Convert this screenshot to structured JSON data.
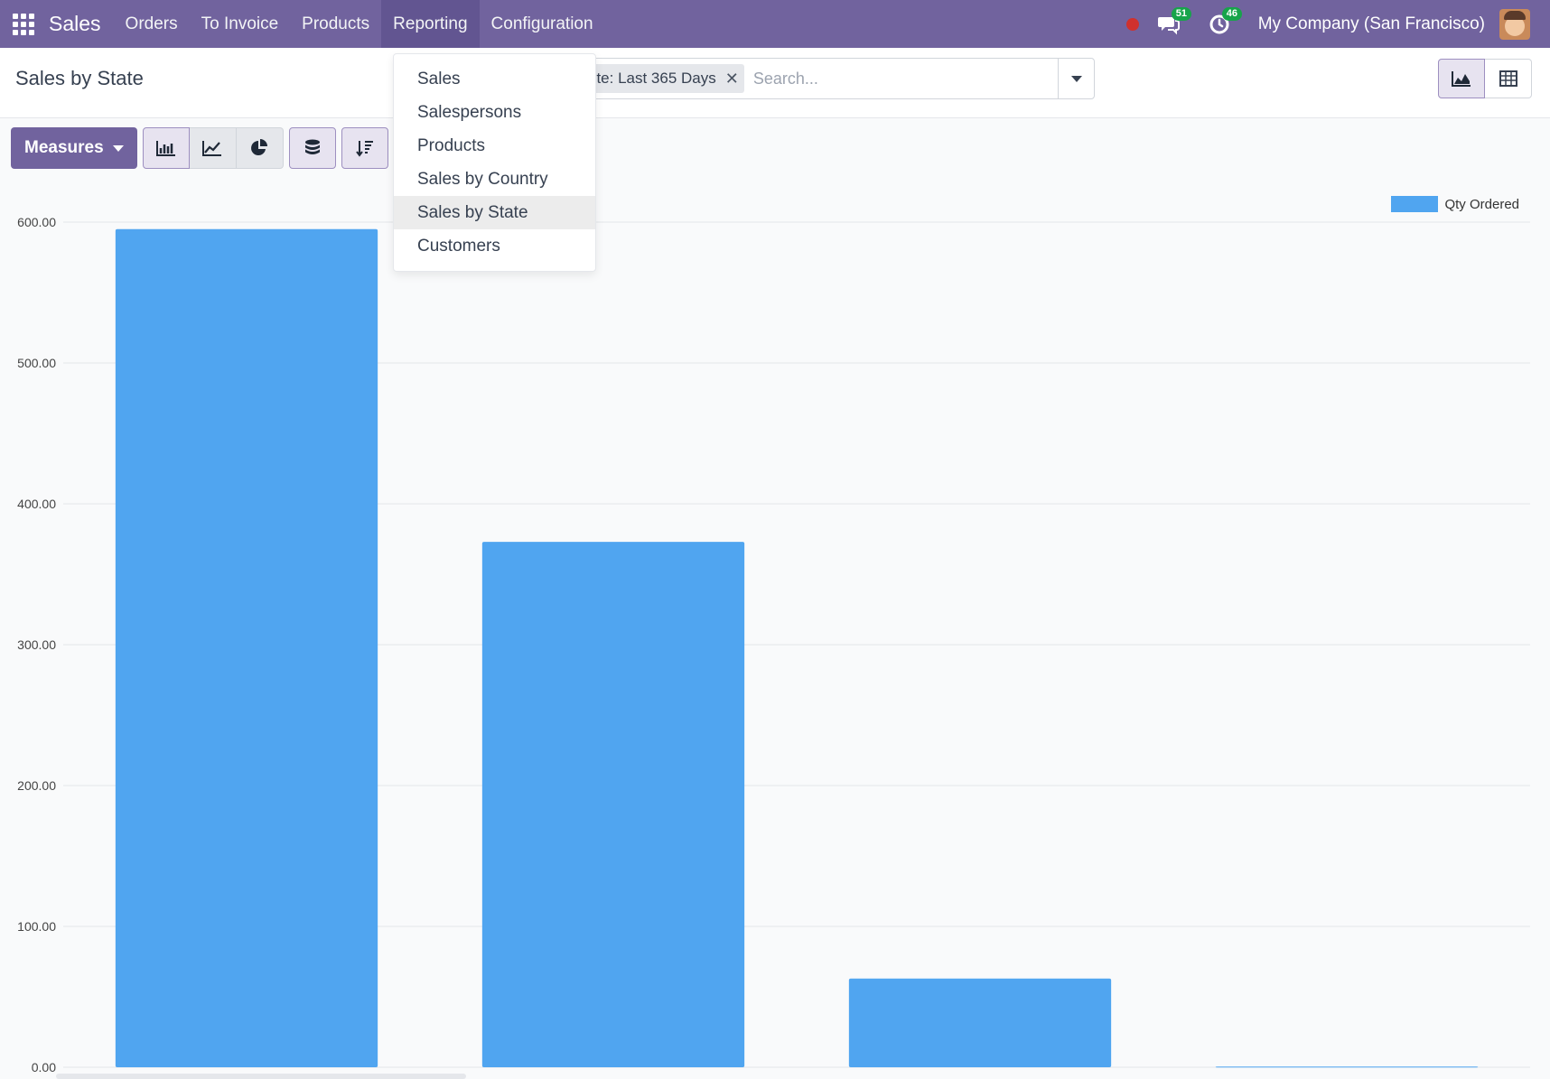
{
  "navbar": {
    "brand": "Sales",
    "items": [
      {
        "label": "Orders"
      },
      {
        "label": "To Invoice"
      },
      {
        "label": "Products"
      },
      {
        "label": "Reporting"
      },
      {
        "label": "Configuration"
      }
    ],
    "messages_count": "51",
    "activities_count": "46",
    "company": "My Company (San Francisco)",
    "colors": {
      "bar": "#71639e",
      "badge": "#17a44a",
      "status_dot": "#d0312d"
    }
  },
  "control_panel": {
    "title": "Sales by State",
    "facet_label": "nte: Last 365 Days",
    "search_placeholder": "Search..."
  },
  "toolbar": {
    "measures_label": "Measures"
  },
  "reporting_menu": {
    "items": [
      {
        "label": "Sales"
      },
      {
        "label": "Salespersons"
      },
      {
        "label": "Products"
      },
      {
        "label": "Sales by Country"
      },
      {
        "label": "Sales by State"
      },
      {
        "label": "Customers"
      }
    ],
    "active_index": 4
  },
  "icons": {
    "apps": "apps-grid-icon",
    "messages": "chat-icon",
    "activities": "clock-icon",
    "graph_view": "area-chart-icon",
    "pivot_view": "table-icon",
    "bar_chart": "bar-chart-icon",
    "line_chart": "line-chart-icon",
    "pie_chart": "pie-chart-icon",
    "stacked": "database-icon",
    "sort": "sort-descending-icon"
  },
  "chart_data": {
    "type": "bar",
    "categories": [
      "",
      "",
      "",
      ""
    ],
    "series": [
      {
        "name": "Qty Ordered",
        "values": [
          595,
          373,
          63,
          0.5
        ],
        "color": "#50a5f0"
      }
    ],
    "ylim": [
      0,
      600
    ],
    "yticks": [
      "0.00",
      "100.00",
      "200.00",
      "300.00",
      "400.00",
      "500.00",
      "600.00"
    ],
    "grid": true,
    "legend": "top-right"
  }
}
